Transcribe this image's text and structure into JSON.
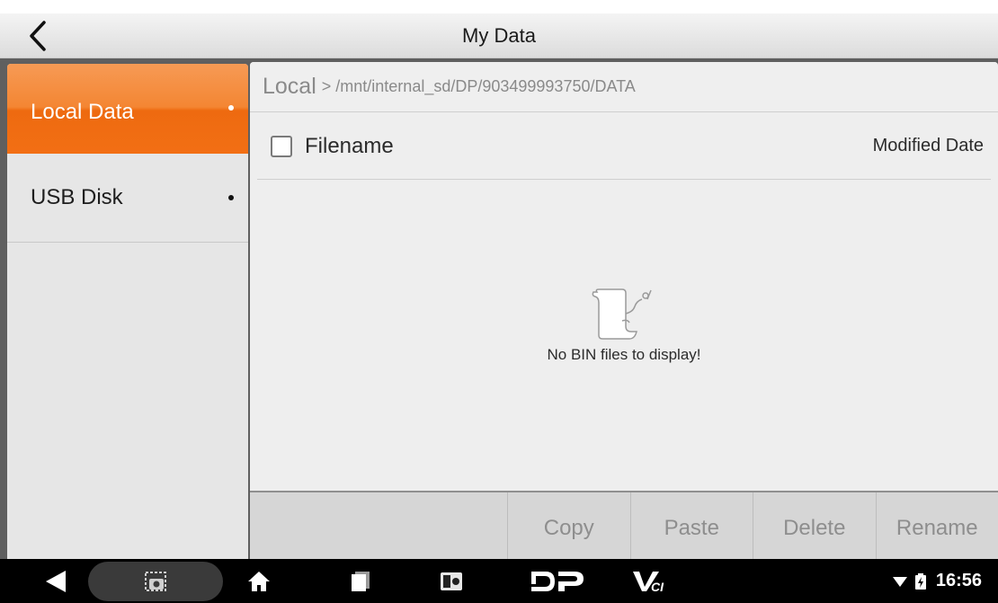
{
  "header": {
    "title": "My Data"
  },
  "sidebar": {
    "items": [
      {
        "label": "Local Data",
        "active": true
      },
      {
        "label": "USB Disk",
        "active": false
      }
    ]
  },
  "breadcrumb": {
    "root": "Local",
    "path": "> /mnt/internal_sd/DP/903499993750/DATA"
  },
  "file_list": {
    "columns": {
      "filename": "Filename",
      "modified": "Modified Date"
    },
    "empty_message": "No BIN files to display!"
  },
  "actions": {
    "copy": "Copy",
    "paste": "Paste",
    "delete": "Delete",
    "rename": "Rename"
  },
  "navbar": {
    "icons": [
      "back-icon",
      "screenshot-icon",
      "home-icon",
      "recents-icon",
      "app-icon",
      "dp-logo-icon",
      "vci-icon"
    ],
    "time": "16:56"
  },
  "colors": {
    "accent": "#f26f14",
    "sidebar_bg": "#e6e6e6",
    "content_bg": "#eeeeee",
    "action_bar_bg": "#d6d6d6",
    "nav_bg": "#000000"
  }
}
